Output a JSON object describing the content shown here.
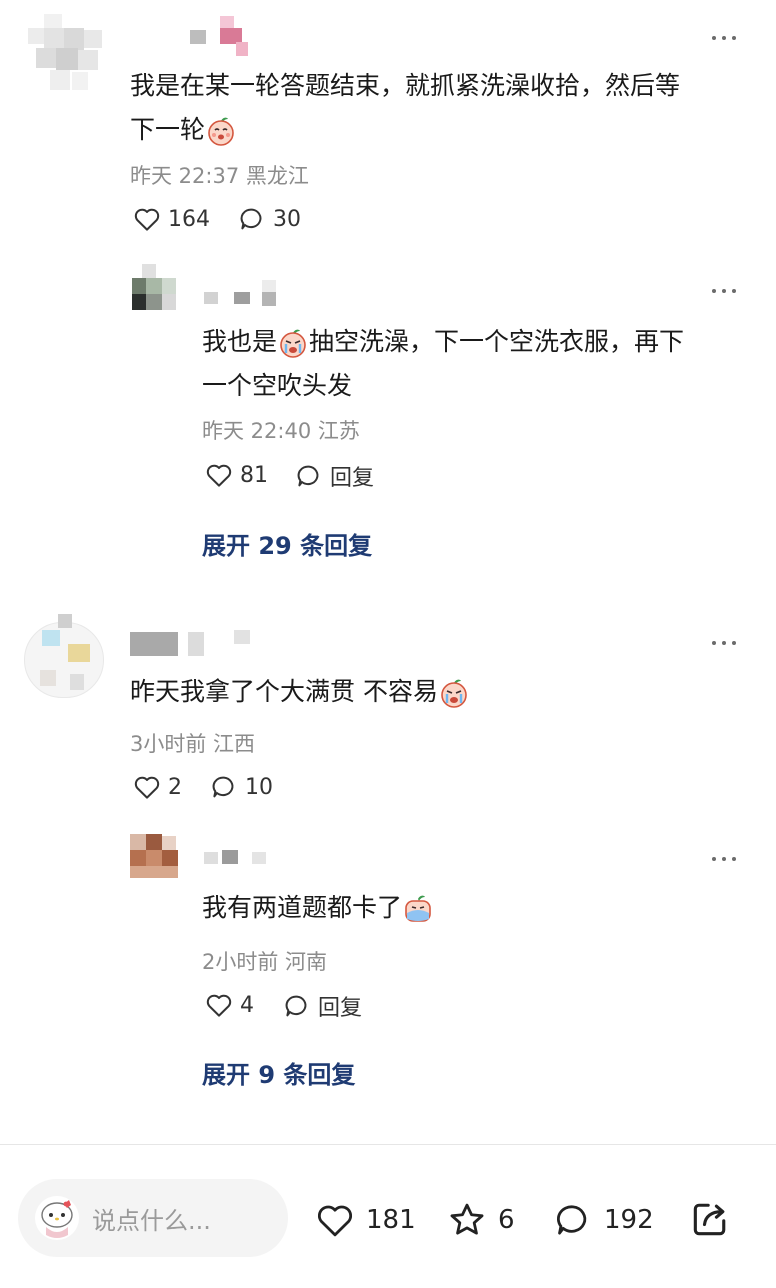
{
  "comments": [
    {
      "text_a": "我是在某一轮答题结束，就抓紧洗澡收拾，然后等",
      "text_b": "下一轮",
      "meta": "昨天 22:37 黑龙江",
      "likes": "164",
      "replies": "30",
      "reply": {
        "text_a": "我也是",
        "text_b": "抽空洗澡，下一个空洗衣服，再下",
        "text_c": "一个空吹头发",
        "meta": "昨天 22:40 江苏",
        "likes": "81",
        "reply_label": "回复"
      },
      "expand": "展开 29 条回复"
    },
    {
      "text": "昨天我拿了个大满贯 不容易",
      "meta": "3小时前 江西",
      "likes": "2",
      "replies": "10",
      "reply": {
        "text": "我有两道题都卡了",
        "meta": "2小时前 河南",
        "likes": "4",
        "reply_label": "回复"
      },
      "expand": "展开 9 条回复"
    }
  ],
  "bottom_bar": {
    "input_placeholder": "说点什么...",
    "likes": "181",
    "favorites": "6",
    "comments": "192"
  },
  "icons": [
    "more-icon",
    "heart-icon",
    "comment-icon",
    "star-icon",
    "share-icon",
    "peach-emoji-icon",
    "crying-emoji-icon"
  ],
  "colors": {
    "expand_link": "#1f3b73",
    "meta_gray": "#8c8c8c"
  }
}
